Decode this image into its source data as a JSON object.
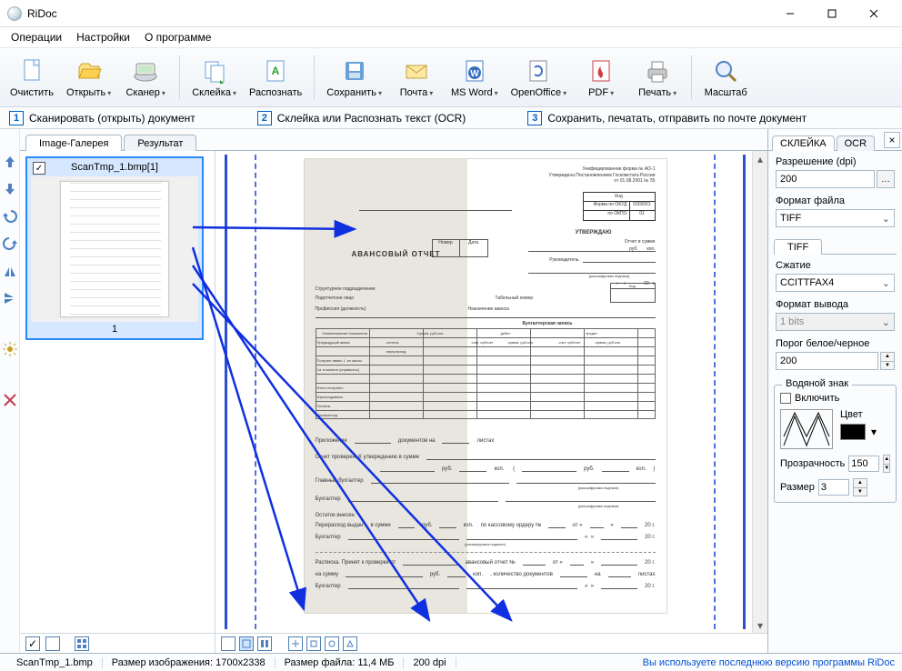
{
  "window": {
    "title": "RiDoc",
    "min_name": "minimize-button",
    "max_name": "maximize-button",
    "close_name": "close-button"
  },
  "menu": {
    "ops": "Операции",
    "settings": "Настройки",
    "about": "О программе"
  },
  "toolbar": {
    "clear": "Очистить",
    "open": "Открыть",
    "scanner": "Сканер",
    "glue": "Склейка",
    "recognize": "Распознать",
    "save": "Сохранить",
    "mail": "Почта",
    "msword": "MS Word",
    "openoffice": "OpenOffice",
    "pdf": "PDF",
    "print": "Печать",
    "zoom": "Масштаб"
  },
  "steps": {
    "s1n": "1",
    "s1": "Сканировать (открыть) документ",
    "s2n": "2",
    "s2": "Склейка или Распознать текст (OCR)",
    "s3n": "3",
    "s3": "Сохранить, печатать, отправить по почте документ"
  },
  "tabs": {
    "gallery": "Image-Галерея",
    "result": "Результат"
  },
  "gallery": {
    "item1_name": "ScanTmp_1.bmp[1]",
    "item1_index": "1"
  },
  "doc": {
    "title": "АВАНСОВЫЙ ОТЧЕТ",
    "unif": "Унифицированная форма № АО-1",
    "approved": "Утверждена Постановлением Госкомстата России",
    "date": "от 01.08.2001 № 55",
    "kod": "Код",
    "okud": "Форма по ОКУД",
    "okud_v": "0302001",
    "okpo": "по ОКПО",
    "okpo_v": "01",
    "nomer": "Номер",
    "data": "Дата",
    "utv": "УТВЕРЖДАЮ",
    "report": "Отчет в сумме",
    "head": "Руководитель",
    "struct": "Структурное подразделение",
    "person": "Подотчетное лицо",
    "prof": "Профессия (должность)",
    "assign": "Назначение аванса",
    "tabno": "Табельный номер",
    "buh": "Бухгалтерская запись",
    "col1": "Наименование показателя",
    "col2": "Сумма, руб.коп.",
    "debet": "дебет",
    "kredit": "кредит",
    "r1": "Предыдущий аванс",
    "r1a": "остаток",
    "r1b": "перерасход",
    "r2": "Получен аванс 1. из кассы",
    "r3": "1а. в валюте (справочно)",
    "r4": "Итого получено",
    "r5": "Израсходовано",
    "r6": "Остаток",
    "r7": "Перерасход",
    "sub1": "счет, субсчет",
    "sub2": "сумма, руб.коп.",
    "pril": "Приложение",
    "pril_docs": "документов на",
    "pril_sheets": "листах",
    "checked": "Отчет проверен. К утверждению в сумме",
    "glav": "Главный бухгалтер",
    "buh2": "Бухгалтер",
    "ost": "Остаток внесен",
    "perer": "Перерасход выдан",
    "vsumme": "в сумме",
    "rub": "руб.",
    "kop": "коп.",
    "order": "по кассовому ордеру №",
    "ot": "от «",
    "god": "20    г.",
    "sign": "(расшифровка подписи)",
    "receipt": "Расписка. Принят к проверке от",
    "avans_report": "авансовый отчет №",
    "na_summu": "на сумму",
    "kol_docs": ", количество документов",
    "na": "на",
    "listax": "листах"
  },
  "right": {
    "tab_glue": "СКЛЕЙКА",
    "tab_ocr": "OCR",
    "close": "×",
    "dpi_label": "Разрешение (dpi)",
    "dpi_value": "200",
    "fmt_label": "Формат файла",
    "fmt_value": "TIFF",
    "tiff_tab": "TIFF",
    "compress_label": "Сжатие",
    "compress_value": "CCITTFAX4",
    "outfmt_label": "Формат вывода",
    "outfmt_value": "1 bits",
    "bw_label": "Порог белое/черное",
    "bw_value": "200",
    "water_legend": "Водяной знак",
    "water_enable": "Включить",
    "color_label": "Цвет",
    "opacity_label": "Прозрачность",
    "opacity_value": "150",
    "size_label": "Размер",
    "size_value": "3"
  },
  "status": {
    "file": "ScanTmp_1.bmp",
    "dims_label": "Размер изображения:",
    "dims_value": "1700x2338",
    "fsize_label": "Размер файла:",
    "fsize_value": "11,4 МБ",
    "dpi": "200 dpi",
    "link": "Вы используете последнюю версию программы RiDoc"
  }
}
